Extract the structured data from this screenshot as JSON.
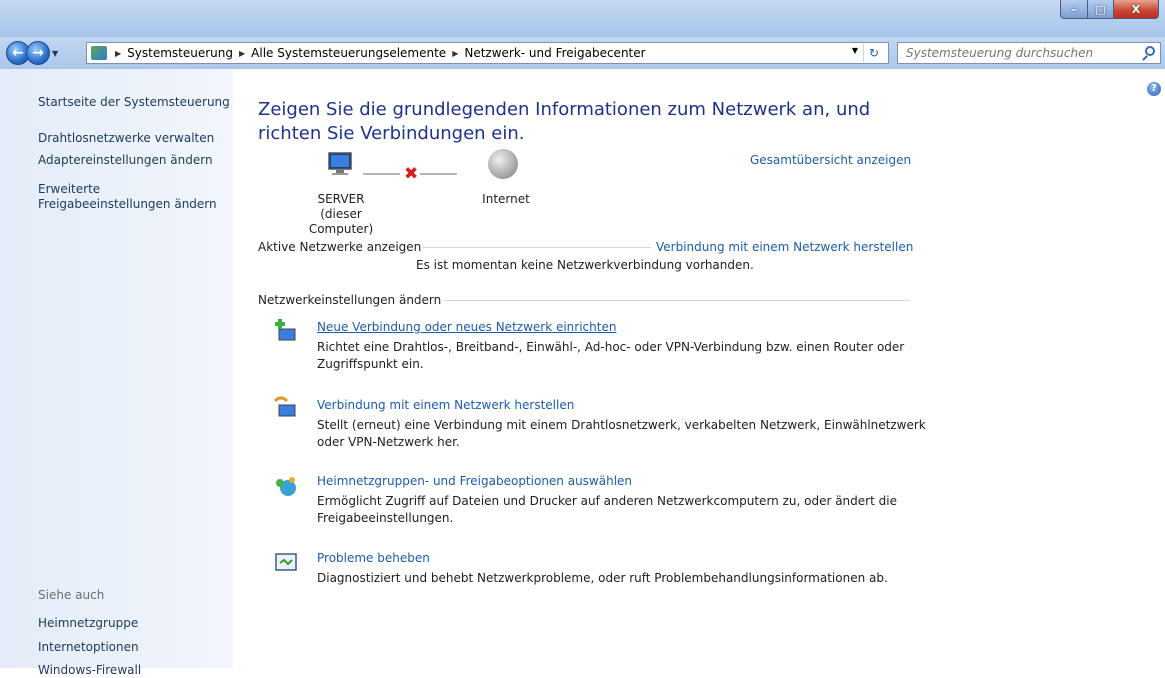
{
  "window": {
    "minimize": "–",
    "maximize": "□",
    "close": "X"
  },
  "address": {
    "breadcrumbs": [
      "Systemsteuerung",
      "Alle Systemsteuerungselemente",
      "Netzwerk- und Freigabecenter"
    ],
    "search_placeholder": "Systemsteuerung durchsuchen"
  },
  "sidebar": {
    "links": [
      "Startseite der Systemsteuerung",
      "Drahtlosnetzwerke verwalten",
      "Adaptereinstellungen ändern",
      "Erweiterte Freigabeeinstellungen ändern"
    ],
    "see_also_title": "Siehe auch",
    "see_also": [
      "Heimnetzgruppe",
      "Internetoptionen",
      "Windows-Firewall"
    ]
  },
  "main": {
    "heading": "Zeigen Sie die grundlegenden Informationen zum Netzwerk an, und richten Sie Verbindungen ein.",
    "overview_link": "Gesamtübersicht anzeigen",
    "computer_name": "SERVER",
    "computer_sub": "(dieser Computer)",
    "internet_label": "Internet",
    "active_networks_title": "Aktive Netzwerke anzeigen",
    "connect_link": "Verbindung mit einem Netzwerk herstellen",
    "no_connection": "Es ist momentan keine Netzwerkverbindung vorhanden.",
    "settings_title": "Netzwerkeinstellungen ändern",
    "tasks": [
      {
        "title": "Neue Verbindung oder neues Netzwerk einrichten",
        "desc": "Richtet eine Drahtlos-, Breitband-, Einwähl-, Ad-hoc- oder VPN-Verbindung bzw. einen Router oder Zugriffspunkt ein."
      },
      {
        "title": "Verbindung mit einem Netzwerk herstellen",
        "desc": "Stellt (erneut) eine Verbindung mit einem Drahtlosnetzwerk, verkabelten Netzwerk, Einwählnetzwerk oder VPN-Netzwerk her."
      },
      {
        "title": "Heimnetzgruppen- und Freigabeoptionen auswählen",
        "desc": "Ermöglicht Zugriff auf Dateien und Drucker auf anderen Netzwerkcomputern zu, oder ändert die Freigabeeinstellungen."
      },
      {
        "title": "Probleme beheben",
        "desc": "Diagnostiziert und behebt Netzwerkprobleme, oder ruft Problembehandlungsinformationen ab."
      }
    ]
  }
}
